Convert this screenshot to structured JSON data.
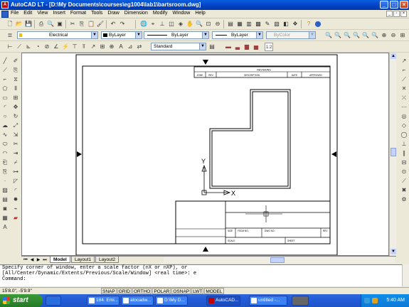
{
  "window": {
    "title": "AutoCAD LT - [D:\\My Documents\\courses\\eg1004\\lab1\\bartsroom.dwg]"
  },
  "menu": {
    "items": [
      "File",
      "Edit",
      "View",
      "Insert",
      "Format",
      "Tools",
      "Draw",
      "Dimension",
      "Modify",
      "Window",
      "Help"
    ]
  },
  "toolbar": {
    "layer": "Electrical",
    "color": "ByLayer",
    "linetype": "ByLayer",
    "lineweight": "ByLayer",
    "plotstyle": "ByColor",
    "textstyle": "Standard"
  },
  "drawing": {
    "revisions_title": "REVISIONS",
    "revision_headers": [
      "ZONE",
      "REV",
      "DESCRIPTION",
      "DATE",
      "APPROVED"
    ],
    "titleblock": {
      "size": "SIZE",
      "fscm": "FSCM NO.",
      "dwg": "DWG NO.",
      "rev": "REV",
      "scale": "SCALE",
      "sheet": "SHEET"
    },
    "ucs_x": "X",
    "ucs_y": "Y"
  },
  "tabs": {
    "model": "Model",
    "layout1": "Layout1",
    "layout2": "Layout2"
  },
  "command": {
    "line1": "Specify corner of window, enter a scale factor (nX or nXP), or",
    "line2": "[All/Center/Dynamic/Extents/Previous/Scale/Window] <real time>: e",
    "line3": "Command:"
  },
  "status": {
    "coords": "15'8.0\", -5'9.9\"",
    "toggles": [
      "SNAP",
      "GRID",
      "ORTHO",
      "POLAR",
      "OSNAP",
      "LWT",
      "MODEL"
    ]
  },
  "taskbar": {
    "start": "start",
    "tasks": [
      "184. Emi...",
      "atocadw...",
      "D:\\My D...",
      "AutoCAD...",
      "untitled -..."
    ],
    "clock": "5:40 AM"
  },
  "colors": {
    "titlebar": "#0040c0",
    "taskbar": "#245edb",
    "start": "#2e8b2e"
  }
}
